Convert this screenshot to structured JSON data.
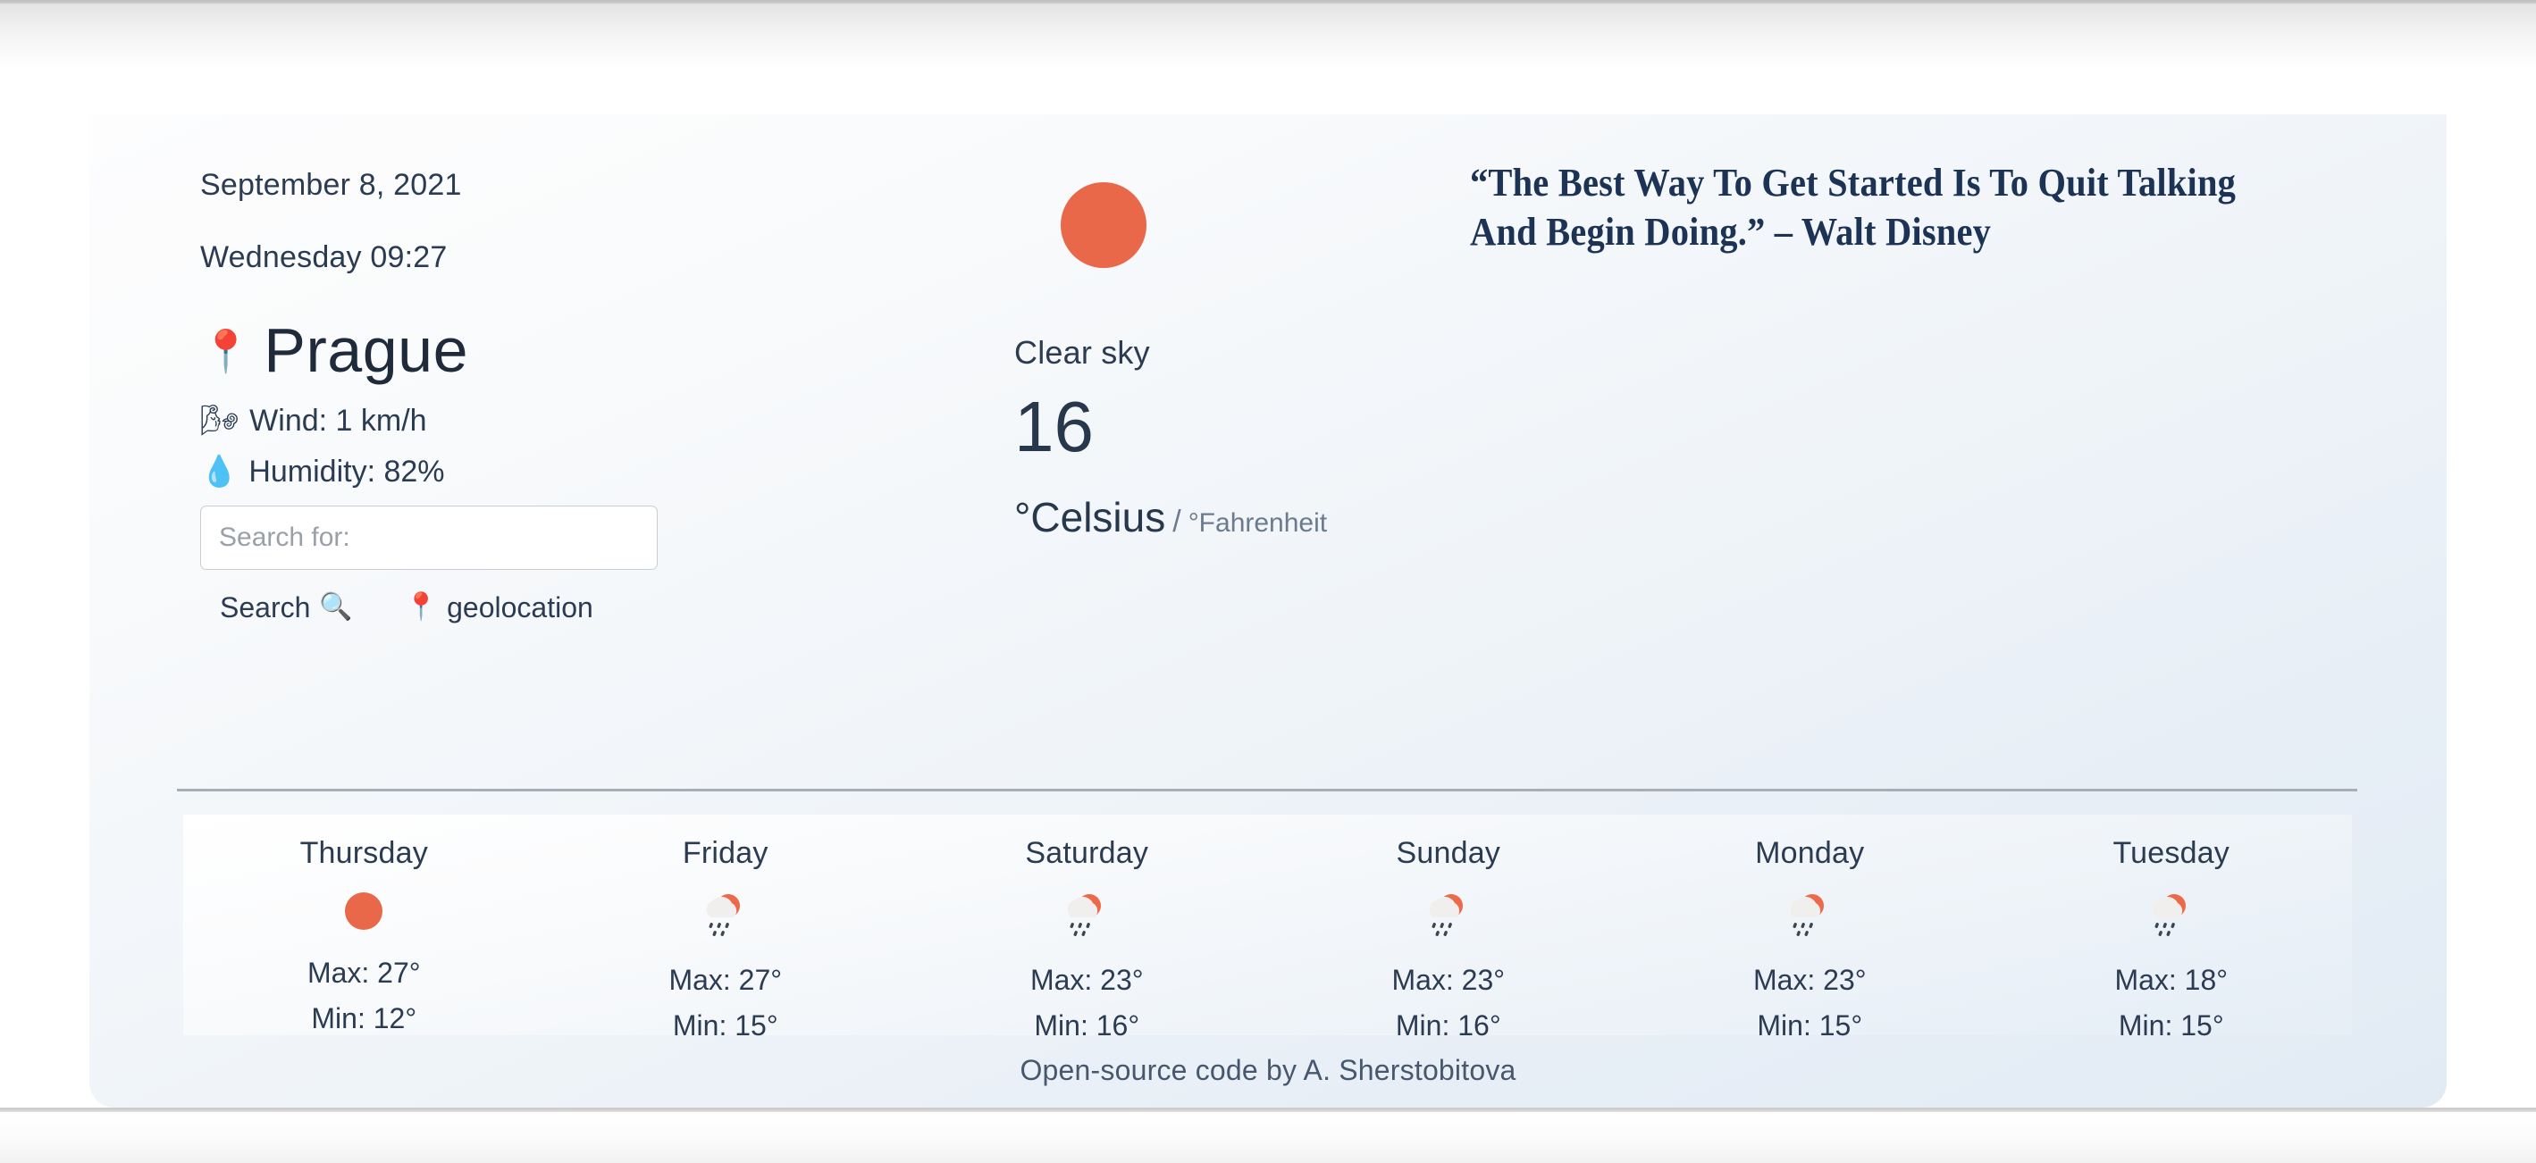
{
  "header": {
    "date": "September 8, 2021",
    "day_time": "Wednesday 09:27"
  },
  "location": {
    "pin_icon": "round-pushpin-icon",
    "city": "Prague",
    "wind_icon": "wind-face-icon",
    "wind": "Wind: 1 km/h",
    "humidity_icon": "droplet-icon",
    "humidity": "Humidity: 82%"
  },
  "search": {
    "placeholder": "Search for:",
    "value": "",
    "search_label": "Search",
    "search_icon": "magnifying-glass-icon",
    "geolocation_label": "geolocation",
    "geolocation_icon": "round-pushpin-icon"
  },
  "current": {
    "icon": "sun-icon",
    "condition": "Clear sky",
    "temperature": "16",
    "unit_celsius": "°Celsius",
    "unit_separator": "/",
    "unit_fahrenheit": "°Fahrenheit"
  },
  "quote": {
    "text": "“The Best Way To Get Started Is To Quit Talking And Begin Doing.” – Walt Disney"
  },
  "forecast": [
    {
      "day": "Thursday",
      "icon": "sun-icon",
      "max": "Max: 27°",
      "min": "Min: 12°"
    },
    {
      "day": "Friday",
      "icon": "sun-rain-cloud-icon",
      "max": "Max: 27°",
      "min": "Min: 15°"
    },
    {
      "day": "Saturday",
      "icon": "sun-rain-cloud-icon",
      "max": "Max: 23°",
      "min": "Min: 16°"
    },
    {
      "day": "Sunday",
      "icon": "sun-rain-cloud-icon",
      "max": "Max: 23°",
      "min": "Min: 16°"
    },
    {
      "day": "Monday",
      "icon": "sun-rain-cloud-icon",
      "max": "Max: 23°",
      "min": "Min: 15°"
    },
    {
      "day": "Tuesday",
      "icon": "sun-rain-cloud-icon",
      "max": "Max: 18°",
      "min": "Min: 15°"
    }
  ],
  "footer": {
    "credit": "Open-source code by A. Sherstobitova"
  },
  "colors": {
    "sun": "#e9684a",
    "text": "#2b3b52",
    "quote": "#1c3355",
    "card_top": "#fdfdfe",
    "card_bottom": "#e2ebf4"
  }
}
